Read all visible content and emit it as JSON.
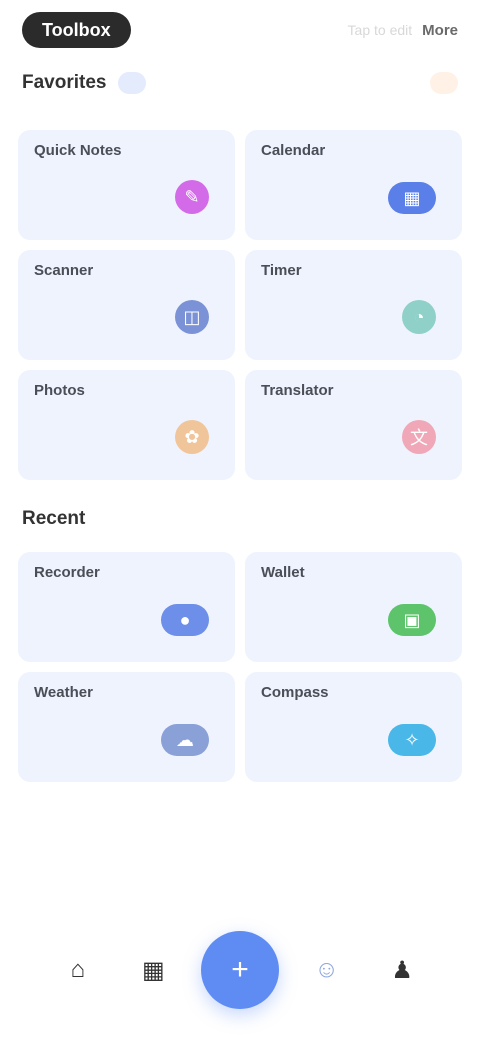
{
  "app": {
    "title": "Toolbox"
  },
  "topbar": {
    "hint": "Tap to edit",
    "link": "More"
  },
  "section1": {
    "title": "Favorites",
    "cards": [
      {
        "label": "Quick Notes",
        "icon": "notes-icon",
        "glyph": "✎",
        "color": "#d36be9"
      },
      {
        "label": "Calendar",
        "icon": "calendar-icon",
        "glyph": "▦",
        "color": "#5b7fe8"
      },
      {
        "label": "Scanner",
        "icon": "scan-icon",
        "glyph": "◫",
        "color": "#7b93d6"
      },
      {
        "label": "Timer",
        "icon": "timer-icon",
        "glyph": "◔",
        "color": "#8fd0c8"
      },
      {
        "label": "Photos",
        "icon": "photo-icon",
        "glyph": "✿",
        "color": "#f1c59a"
      },
      {
        "label": "Translator",
        "icon": "translate-icon",
        "glyph": "文",
        "color": "#f0a7b7"
      }
    ]
  },
  "section2": {
    "title": "Recent",
    "cards": [
      {
        "label": "Recorder",
        "icon": "mic-icon",
        "glyph": "●",
        "color": "#6d8fe9"
      },
      {
        "label": "Wallet",
        "icon": "wallet-icon",
        "glyph": "▣",
        "color": "#5dc46b"
      },
      {
        "label": "Weather",
        "icon": "weather-icon",
        "glyph": "☁",
        "color": "#8aa1d8"
      },
      {
        "label": "Compass",
        "icon": "compass-icon",
        "glyph": "✧",
        "color": "#49b7e8"
      }
    ]
  },
  "bottom_nav": {
    "items": [
      "home-icon",
      "grid-icon",
      "plus-icon",
      "chat-icon",
      "profile-icon"
    ],
    "glyphs": [
      "⌂",
      "▦",
      "+",
      "☺",
      "♟"
    ]
  }
}
